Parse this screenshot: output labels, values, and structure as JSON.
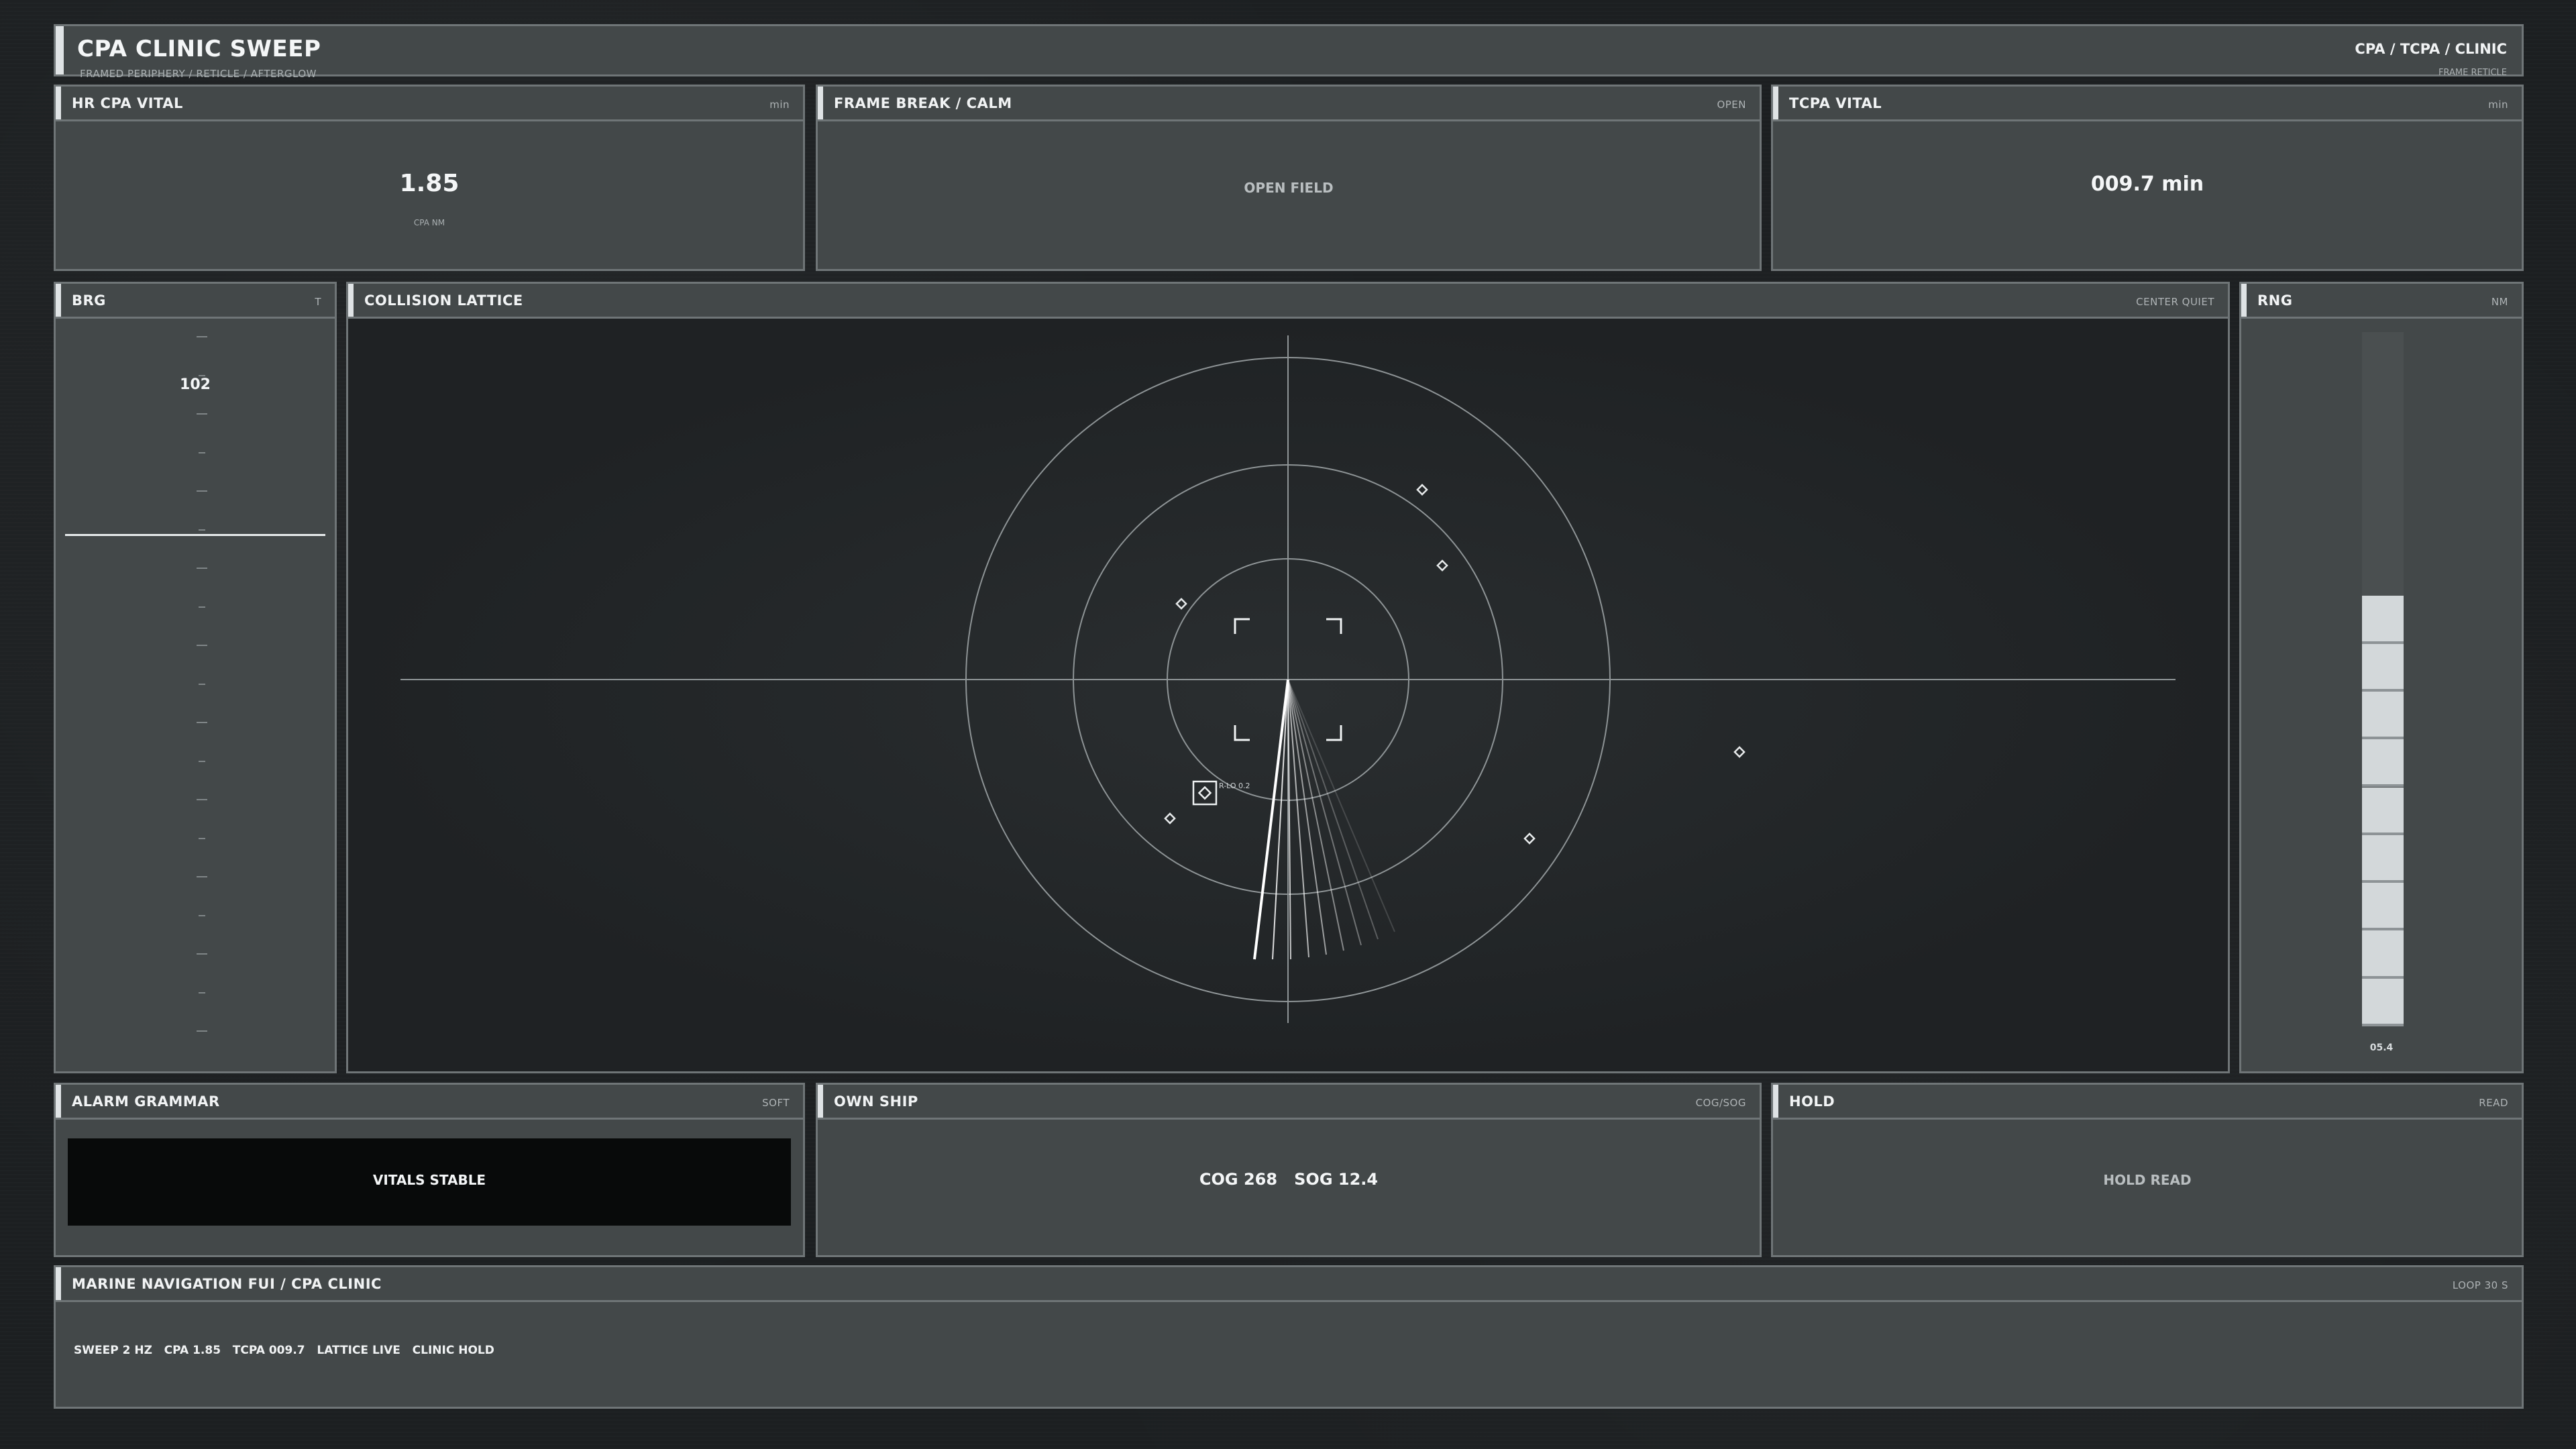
{
  "header": {
    "title": "CPA CLINIC SWEEP",
    "subtitle": "FRAMED PERIPHERY  /  RETICLE  /  AFTERGLOW",
    "right": "CPA  /  TCPA  /  CLINIC",
    "right_sub": "FRAME  RETICLE"
  },
  "cpa_panel": {
    "title": "HR  CPA VITAL",
    "tag": "min",
    "value": "1.85",
    "caption": "CPA NM"
  },
  "frame_panel": {
    "title": "FRAME BREAK  /  CALM",
    "tag": "OPEN",
    "value": "OPEN FIELD"
  },
  "tcpa_panel": {
    "title": "TCPA VITAL",
    "tag": "min",
    "value": "009.7 min"
  },
  "brg_panel": {
    "title": "BRG",
    "tag": "T",
    "value": "102"
  },
  "lattice_panel": {
    "title": "COLLISION LATTICE",
    "tag": "CENTER QUIET",
    "target_label": "R-LO 0.2"
  },
  "rng_panel": {
    "title": "RNG",
    "tag": "NM",
    "value": "05.4",
    "level_fraction": 0.62,
    "segments": 9
  },
  "alarm_panel": {
    "title": "ALARM GRAMMAR",
    "tag": "SOFT",
    "value": "VITALS STABLE"
  },
  "ownship_panel": {
    "title": "OWN SHIP",
    "tag": "COG/SOG",
    "value": "COG 268   SOG 12.4"
  },
  "hold_panel": {
    "title": "HOLD",
    "tag": "READ",
    "value": "HOLD READ"
  },
  "footer_panel": {
    "title": "MARINE NAVIGATION FUI  /  CPA CLINIC",
    "tag": "LOOP 30 S",
    "ticker": "SWEEP 2 HZ   CPA 1.85   TCPA 009.7   LATTICE LIVE   CLINIC HOLD"
  },
  "colors": {
    "background": "#1c1f21",
    "panel": "#434849",
    "border": "#6f7577",
    "accent": "#dfe3e5",
    "alarm_box": "#080a0a"
  }
}
